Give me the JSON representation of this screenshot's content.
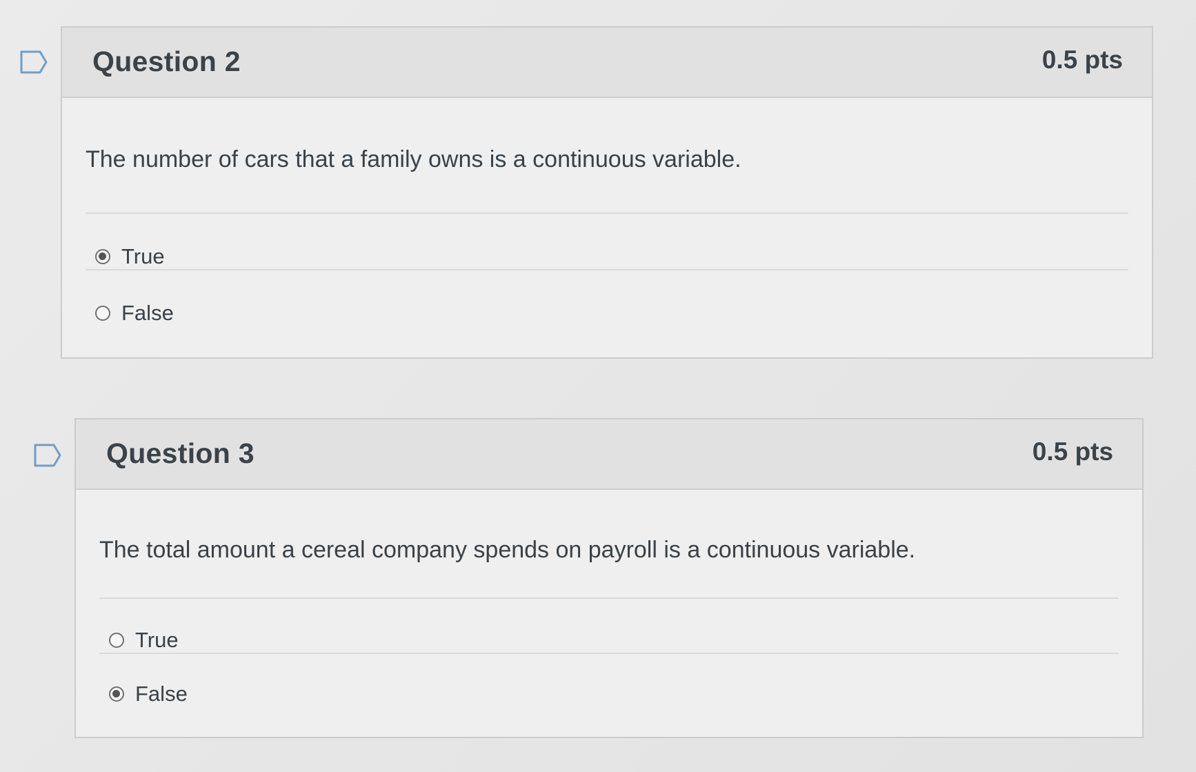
{
  "questions": [
    {
      "title": "Question 2",
      "points": "0.5 pts",
      "text": "The number of cars that a family owns is a continuous variable.",
      "answers": [
        {
          "label": "True",
          "selected": true
        },
        {
          "label": "False",
          "selected": false
        }
      ]
    },
    {
      "title": "Question 3",
      "points": "0.5 pts",
      "text": "The total amount a cereal company spends on payroll is a continuous variable.",
      "answers": [
        {
          "label": "True",
          "selected": false
        },
        {
          "label": "False",
          "selected": true
        }
      ]
    }
  ],
  "icons": {
    "flag": "flag-question-icon"
  },
  "colors": {
    "header_bg": "#e1e1e1",
    "card_bg": "#efefef",
    "text": "#3a4147"
  }
}
